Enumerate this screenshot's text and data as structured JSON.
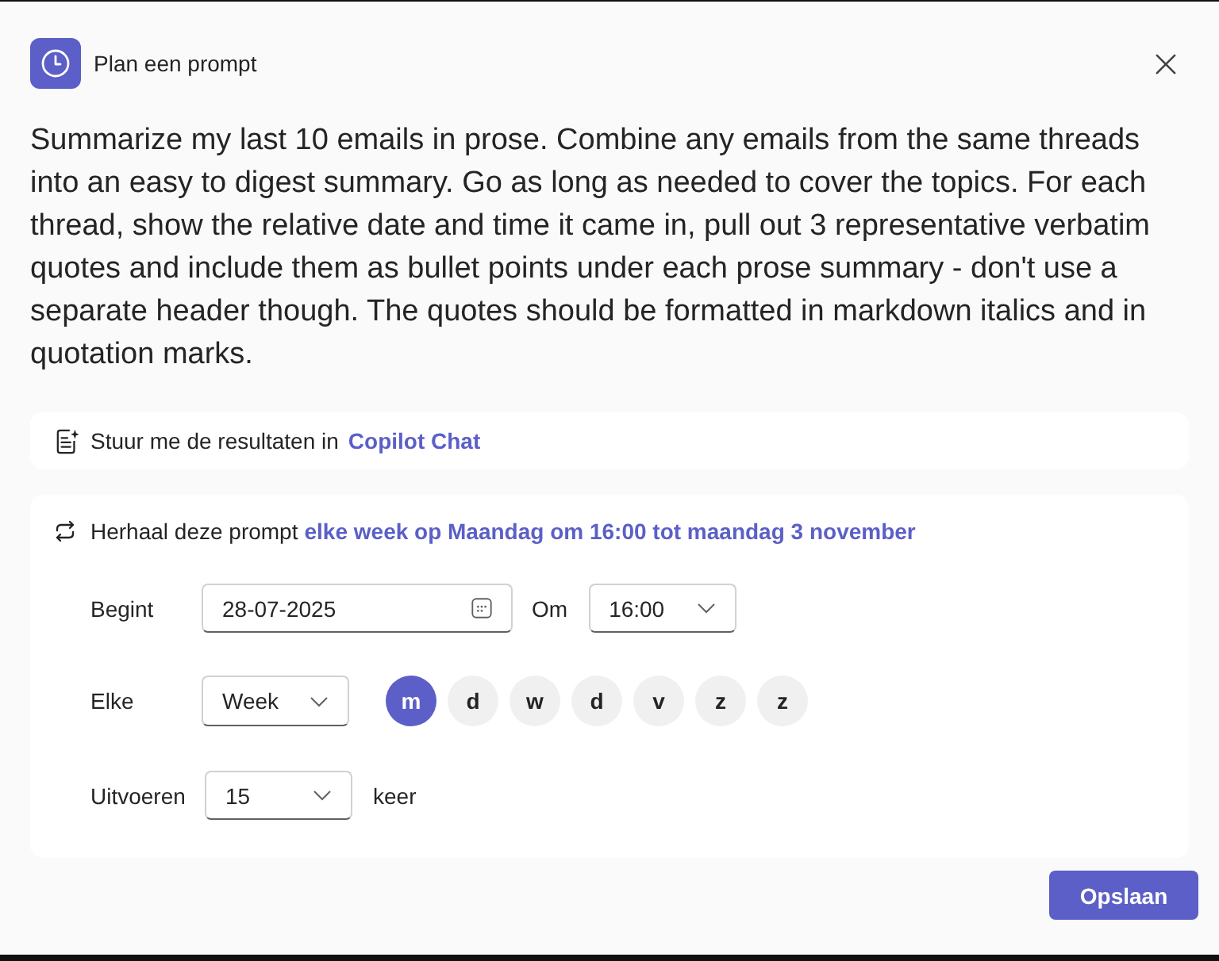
{
  "header": {
    "title": "Plan een prompt"
  },
  "prompt": "Summarize my last 10 emails in prose. Combine any emails from the same threads into an easy to digest summary. Go as long as needed to cover the topics. For each thread, show the relative date and time it came in, pull out 3 representative verbatim quotes and include them as bullet points under each prose summary - don't use a separate header though. The quotes should be formatted in markdown italics and in quotation marks.",
  "delivery": {
    "label": "Stuur me de resultaten in",
    "link": "Copilot Chat"
  },
  "recurrence": {
    "label": "Herhaal deze prompt",
    "summary": "elke week op Maandag om 16:00 tot maandag 3 november",
    "start": {
      "label": "Begint",
      "date_value": "28-07-2025",
      "time_label": "Om",
      "time_value": "16:00"
    },
    "frequency": {
      "label": "Elke",
      "value": "Week",
      "days": [
        {
          "label": "m",
          "selected": true
        },
        {
          "label": "d",
          "selected": false
        },
        {
          "label": "w",
          "selected": false
        },
        {
          "label": "d",
          "selected": false
        },
        {
          "label": "v",
          "selected": false
        },
        {
          "label": "z",
          "selected": false
        },
        {
          "label": "z",
          "selected": false
        }
      ]
    },
    "occurrences": {
      "label": "Uitvoeren",
      "value": "15",
      "suffix": "keer"
    }
  },
  "primary_button": "Opslaan"
}
